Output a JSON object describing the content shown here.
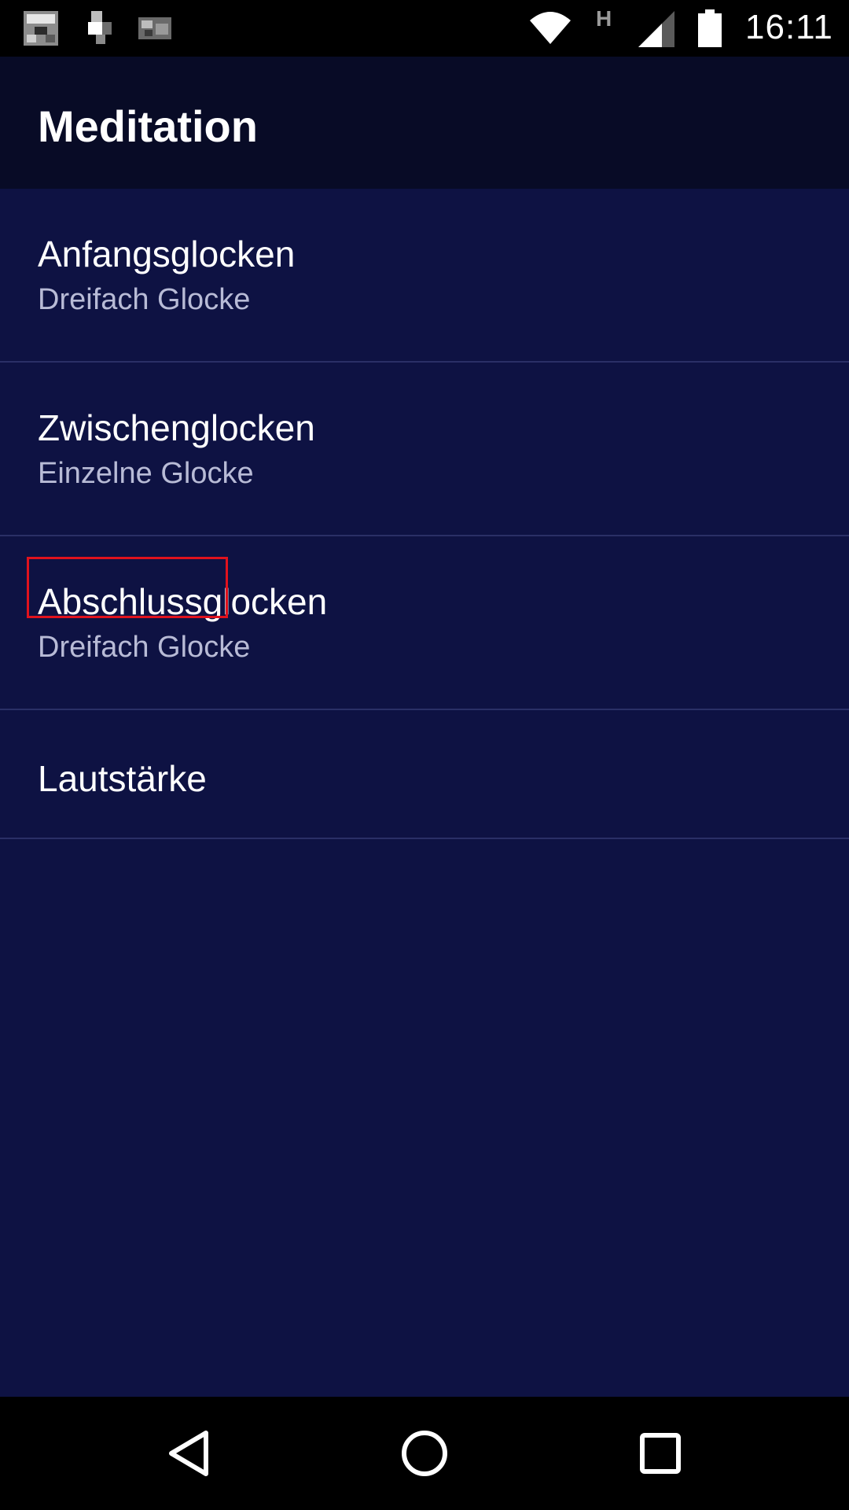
{
  "status_bar": {
    "time": "16:11",
    "network_type": "H",
    "icons": [
      "notification-image-icon",
      "notification-app-icon",
      "notification-message-icon",
      "wifi-icon",
      "signal-icon",
      "battery-icon"
    ]
  },
  "app_bar": {
    "title": "Meditation"
  },
  "preferences": [
    {
      "title": "Anfangsglocken",
      "summary": "Dreifach Glocke"
    },
    {
      "title": "Zwischenglocken",
      "summary": "Einzelne Glocke"
    },
    {
      "title": "Abschlussglocken",
      "summary": "Dreifach Glocke"
    },
    {
      "title": "Lautstärke"
    }
  ],
  "nav_bar": {
    "icons": [
      "back-icon",
      "home-icon",
      "recents-icon"
    ]
  },
  "colors": {
    "background": "#0e1243",
    "app_bar": "#080b26",
    "divider": "#2a2f66",
    "summary_text": "#b8bbd6",
    "highlight": "#e0121d"
  }
}
